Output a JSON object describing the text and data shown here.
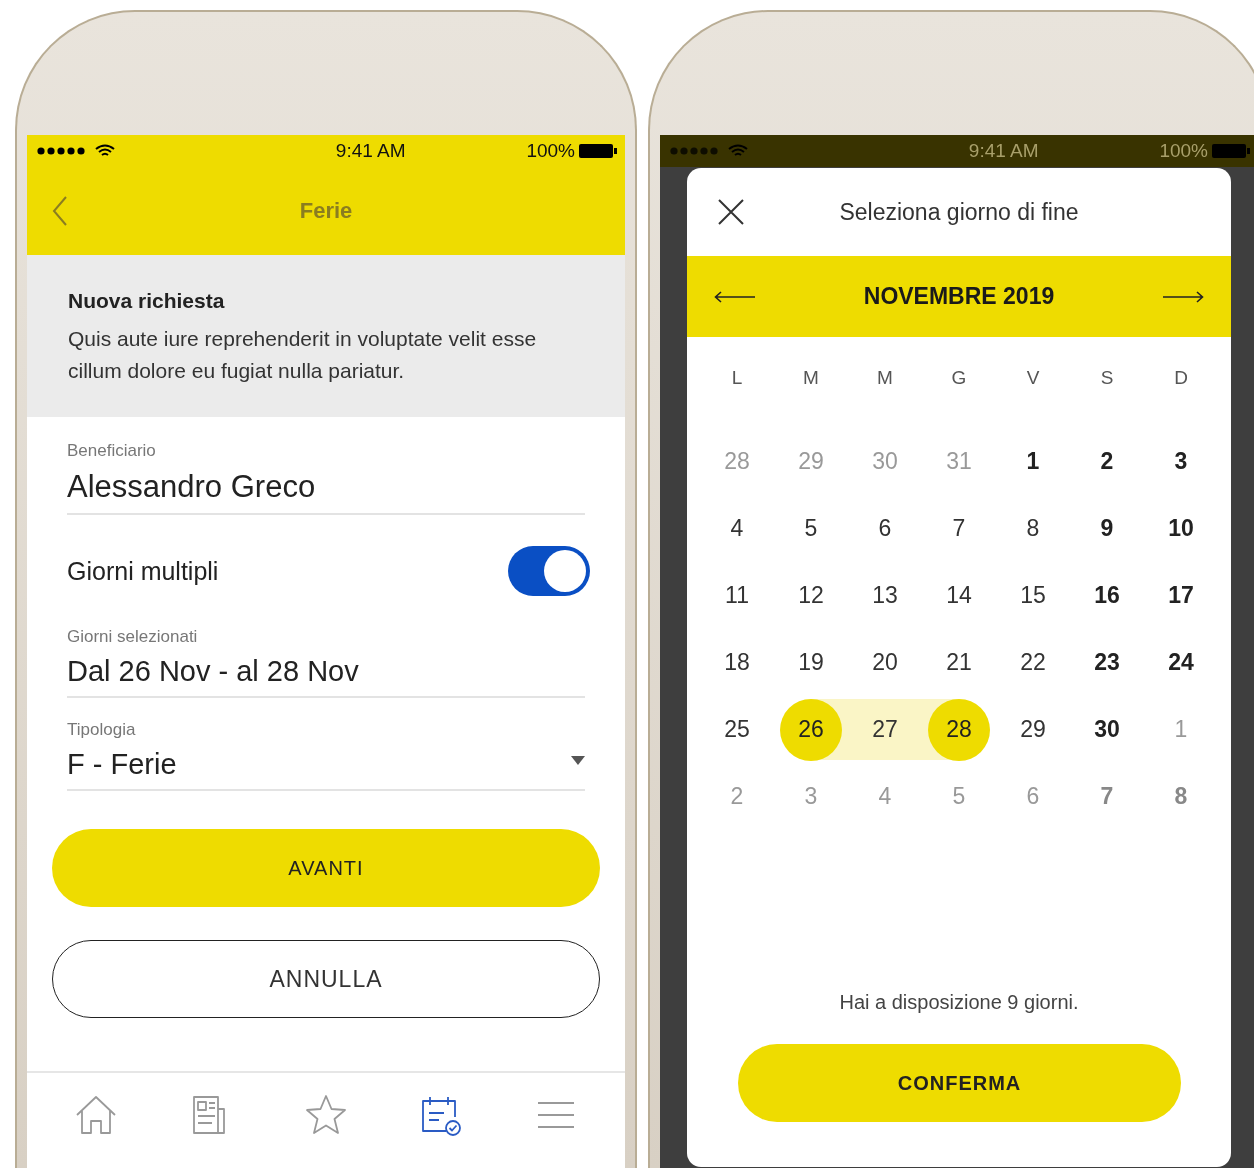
{
  "left_phone": {
    "status_bar": {
      "time": "9:41 AM",
      "battery": "100%"
    },
    "nav_bar": {
      "title": "Ferie"
    },
    "intro": {
      "title": "Nuova richiesta",
      "text": "Quis aute iure reprehenderit in voluptate velit esse cillum dolore eu fugiat nulla pariatur."
    },
    "beneficiary": {
      "label": "Beneficiario",
      "value": "Alessandro Greco"
    },
    "multiple_days": {
      "label": "Giorni multipli",
      "on": true
    },
    "selected_days": {
      "label": "Giorni selezionati",
      "value": "Dal 26 Nov - al 28 Nov"
    },
    "type": {
      "label": "Tipologia",
      "value": "F - Ferie"
    },
    "buttons": [
      {
        "label": "AVANTI",
        "kind": "primary"
      },
      {
        "label": "ANNULLA",
        "kind": "outline"
      }
    ],
    "tab_bar": [
      {
        "kind": "home",
        "selected": false
      },
      {
        "kind": "news",
        "selected": false
      },
      {
        "kind": "star",
        "selected": false
      },
      {
        "kind": "calendar",
        "selected": true
      },
      {
        "kind": "menu",
        "selected": false
      }
    ]
  },
  "right_phone": {
    "status_bar": {
      "time": "9:41 AM",
      "battery": "100%"
    },
    "modal": {
      "title": "Seleziona giorno di fine",
      "month": "NOVEMBRE 2019",
      "weekdays": [
        "L",
        "M",
        "M",
        "G",
        "V",
        "S",
        "D"
      ],
      "days": [
        {
          "label": "28",
          "kind": "other",
          "selected": false,
          "in_range": false
        },
        {
          "label": "29",
          "kind": "other",
          "selected": false,
          "in_range": false
        },
        {
          "label": "30",
          "kind": "other",
          "selected": false,
          "in_range": false
        },
        {
          "label": "31",
          "kind": "other",
          "selected": false,
          "in_range": false
        },
        {
          "label": "1",
          "kind": "bold",
          "selected": false,
          "in_range": false
        },
        {
          "label": "2",
          "kind": "bold",
          "selected": false,
          "in_range": false
        },
        {
          "label": "3",
          "kind": "bold",
          "selected": false,
          "in_range": false
        },
        {
          "label": "4",
          "kind": "weekday",
          "selected": false,
          "in_range": false
        },
        {
          "label": "5",
          "kind": "weekday",
          "selected": false,
          "in_range": false
        },
        {
          "label": "6",
          "kind": "weekday",
          "selected": false,
          "in_range": false
        },
        {
          "label": "7",
          "kind": "weekday",
          "selected": false,
          "in_range": false
        },
        {
          "label": "8",
          "kind": "weekday",
          "selected": false,
          "in_range": false
        },
        {
          "label": "9",
          "kind": "bold",
          "selected": false,
          "in_range": false
        },
        {
          "label": "10",
          "kind": "bold",
          "selected": false,
          "in_range": false
        },
        {
          "label": "11",
          "kind": "weekday",
          "selected": false,
          "in_range": false
        },
        {
          "label": "12",
          "kind": "weekday",
          "selected": false,
          "in_range": false
        },
        {
          "label": "13",
          "kind": "weekday",
          "selected": false,
          "in_range": false
        },
        {
          "label": "14",
          "kind": "weekday",
          "selected": false,
          "in_range": false
        },
        {
          "label": "15",
          "kind": "weekday",
          "selected": false,
          "in_range": false
        },
        {
          "label": "16",
          "kind": "bold",
          "selected": false,
          "in_range": false
        },
        {
          "label": "17",
          "kind": "bold",
          "selected": false,
          "in_range": false
        },
        {
          "label": "18",
          "kind": "weekday",
          "selected": false,
          "in_range": false
        },
        {
          "label": "19",
          "kind": "weekday",
          "selected": false,
          "in_range": false
        },
        {
          "label": "20",
          "kind": "weekday",
          "selected": false,
          "in_range": false
        },
        {
          "label": "21",
          "kind": "weekday",
          "selected": false,
          "in_range": false
        },
        {
          "label": "22",
          "kind": "weekday",
          "selected": false,
          "in_range": false
        },
        {
          "label": "23",
          "kind": "bold",
          "selected": false,
          "in_range": false
        },
        {
          "label": "24",
          "kind": "bold",
          "selected": false,
          "in_range": false
        },
        {
          "label": "25",
          "kind": "weekday",
          "selected": false,
          "in_range": false
        },
        {
          "label": "26",
          "kind": "weekday",
          "selected": true,
          "in_range": false
        },
        {
          "label": "27",
          "kind": "weekday",
          "selected": false,
          "in_range": true
        },
        {
          "label": "28",
          "kind": "weekday",
          "selected": true,
          "in_range": false
        },
        {
          "label": "29",
          "kind": "weekday",
          "selected": false,
          "in_range": false
        },
        {
          "label": "30",
          "kind": "bold",
          "selected": false,
          "in_range": false
        },
        {
          "label": "1",
          "kind": "other",
          "selected": false,
          "in_range": false
        },
        {
          "label": "2",
          "kind": "other",
          "selected": false,
          "in_range": false
        },
        {
          "label": "3",
          "kind": "other",
          "selected": false,
          "in_range": false
        },
        {
          "label": "4",
          "kind": "other",
          "selected": false,
          "in_range": false
        },
        {
          "label": "5",
          "kind": "other",
          "selected": false,
          "in_range": false
        },
        {
          "label": "6",
          "kind": "other",
          "selected": false,
          "in_range": false
        },
        {
          "label": "7",
          "kind": "other_bold",
          "selected": false,
          "in_range": false
        },
        {
          "label": "8",
          "kind": "other_bold",
          "selected": false,
          "in_range": false
        }
      ],
      "note": "Hai a disposizione 9 giorni.",
      "confirm": "CONFERMA"
    }
  }
}
